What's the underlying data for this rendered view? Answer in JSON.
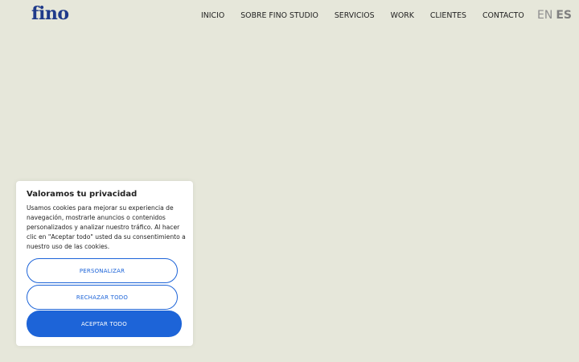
{
  "header": {
    "logo": "fino",
    "nav": [
      "INICIO",
      "SOBRE FINO STUDIO",
      "SERVICIOS",
      "WORK",
      "CLIENTES",
      "CONTACTO"
    ],
    "lang": {
      "en": "EN",
      "es": "ES"
    }
  },
  "cookie": {
    "title": "Valoramos tu privacidad",
    "text": "Usamos cookies para mejorar su experiencia de navegación, mostrarle anuncios o contenidos personalizados y analizar nuestro tráfico. Al hacer clic en \"Aceptar todo\" usted da su consentimiento a nuestro uso de las cookies.",
    "buttons": {
      "personalizar": "PERSONALIZAR",
      "rechazar": "RECHAZAR TODO",
      "aceptar": "ACEPTAR TODO"
    }
  },
  "colors": {
    "background": "#e6e7da",
    "brand": "#1f3a8a",
    "accent": "#1d64d8"
  }
}
